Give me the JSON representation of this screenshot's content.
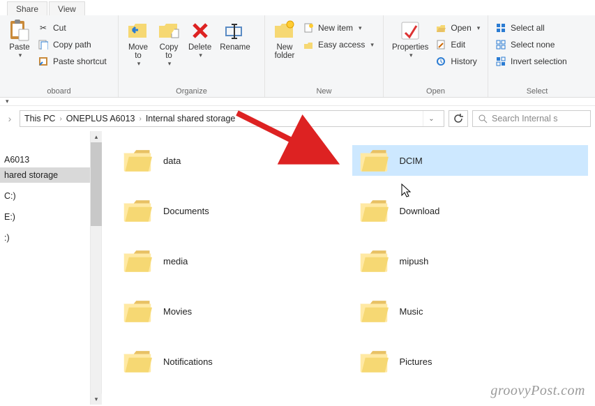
{
  "tabs": {
    "share": "Share",
    "view": "View"
  },
  "ribbon": {
    "clipboard": {
      "label": "oboard",
      "paste": "Paste",
      "cut": "Cut",
      "copy_path": "Copy path",
      "paste_shortcut": "Paste shortcut"
    },
    "organize": {
      "label": "Organize",
      "move_to": "Move\nto",
      "copy_to": "Copy\nto",
      "delete": "Delete",
      "rename": "Rename"
    },
    "new": {
      "label": "New",
      "new_folder": "New\nfolder",
      "new_item": "New item",
      "easy_access": "Easy access"
    },
    "open": {
      "label": "Open",
      "properties": "Properties",
      "open": "Open",
      "edit": "Edit",
      "history": "History"
    },
    "select": {
      "label": "Select",
      "select_all": "Select all",
      "select_none": "Select none",
      "invert": "Invert selection"
    }
  },
  "breadcrumbs": [
    "This PC",
    "ONEPLUS A6013",
    "Internal shared storage"
  ],
  "search_placeholder": "Search Internal s",
  "nav": {
    "items": [
      "A6013",
      "hared storage",
      "",
      "C:)",
      "",
      "E:)",
      "",
      ":)"
    ]
  },
  "folders": [
    {
      "name": "data",
      "selected": false
    },
    {
      "name": "DCIM",
      "selected": true
    },
    {
      "name": "Documents",
      "selected": false
    },
    {
      "name": "Download",
      "selected": false
    },
    {
      "name": "media",
      "selected": false
    },
    {
      "name": "mipush",
      "selected": false
    },
    {
      "name": "Movies",
      "selected": false
    },
    {
      "name": "Music",
      "selected": false
    },
    {
      "name": "Notifications",
      "selected": false
    },
    {
      "name": "Pictures",
      "selected": false
    }
  ],
  "watermark": "groovyPost.com"
}
